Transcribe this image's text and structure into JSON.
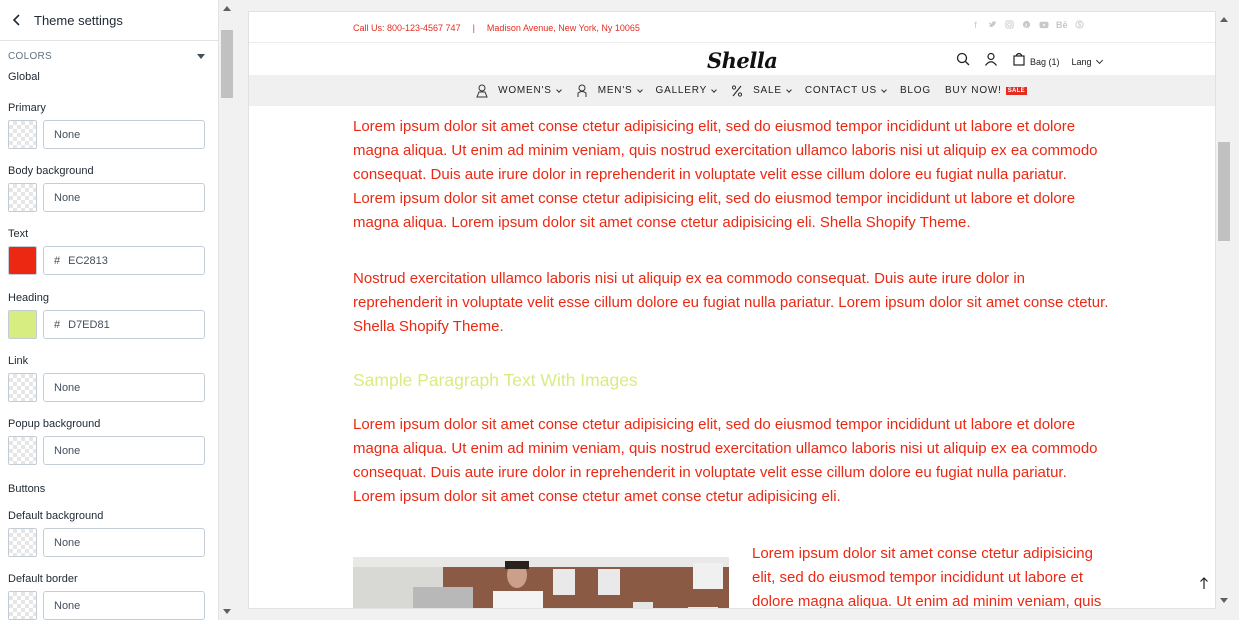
{
  "sidebar": {
    "title": "Theme settings",
    "section": "COLORS",
    "group_global": "Global",
    "fields": [
      {
        "label": "Primary",
        "value": "None"
      },
      {
        "label": "Body background",
        "value": "None"
      },
      {
        "label": "Text",
        "value": "EC2813",
        "color": "#EC2813"
      },
      {
        "label": "Heading",
        "value": "D7ED81",
        "color": "#D7ED81"
      },
      {
        "label": "Link",
        "value": "None"
      },
      {
        "label": "Popup background",
        "value": "None"
      },
      {
        "label": "Default background",
        "value": "None"
      },
      {
        "label": "Default border",
        "value": "None"
      }
    ],
    "group_buttons": "Buttons",
    "hash": "#"
  },
  "store": {
    "phone": "Call Us: 800-123-4567 747",
    "separator": "|",
    "address": "Madison Avenue, New York, Ny 10065",
    "logo": "Shella",
    "bag": "Bag (1)",
    "lang": "Lang",
    "nav": [
      "WOMEN'S",
      "MEN'S",
      "GALLERY",
      "SALE",
      "CONTACT US",
      "BLOG",
      "BUY NOW!"
    ],
    "sale_badge": "SALE",
    "social_icons": [
      "facebook-icon",
      "twitter-icon",
      "instagram-icon",
      "pinterest-icon",
      "youtube-icon",
      "behance-icon",
      "skype-icon"
    ]
  },
  "content": {
    "paragraph1": "Lorem ipsum dolor sit amet conse ctetur adipisicing elit, sed do eiusmod tempor incididunt ut labore et dolore magna aliqua. Ut enim ad minim veniam, quis nostrud exercitation ullamco laboris nisi ut aliquip ex ea commodo consequat. Duis aute irure dolor in reprehenderit in voluptate velit esse cillum dolore eu fugiat nulla pariatur. Lorem ipsum dolor sit amet conse ctetur adipisicing elit, sed do eiusmod tempor incididunt ut labore et dolore magna aliqua. Lorem ipsum dolor sit amet conse ctetur adipisicing eli. Shella Shopify Theme.",
    "paragraph2": "Nostrud exercitation ullamco laboris nisi ut aliquip ex ea commodo consequat. Duis aute irure dolor in reprehenderit in voluptate velit esse cillum dolore eu fugiat nulla pariatur. Lorem ipsum dolor sit amet conse ctetur. Shella Shopify Theme.",
    "heading": "Sample Paragraph Text With Images",
    "paragraph3": "Lorem ipsum dolor sit amet conse ctetur adipisicing elit, sed do eiusmod tempor incididunt ut labore et dolore magna aliqua. Ut enim ad minim veniam, quis nostrud exercitation ullamco laboris nisi ut aliquip ex ea commodo consequat. Duis aute irure dolor in reprehenderit in voluptate velit esse cillum dolore eu fugiat nulla pariatur. Lorem ipsum dolor sit amet conse ctetur amet conse ctetur adipisicing eli.",
    "side_text": "Lorem ipsum dolor sit amet conse ctetur adipisicing elit, sed do eiusmod tempor incididunt ut labore et dolore magna aliqua. Ut enim ad minim veniam, quis"
  },
  "colors": {
    "text": "#EC2813",
    "heading": "#D7ED81",
    "accent": "#E42D20"
  }
}
